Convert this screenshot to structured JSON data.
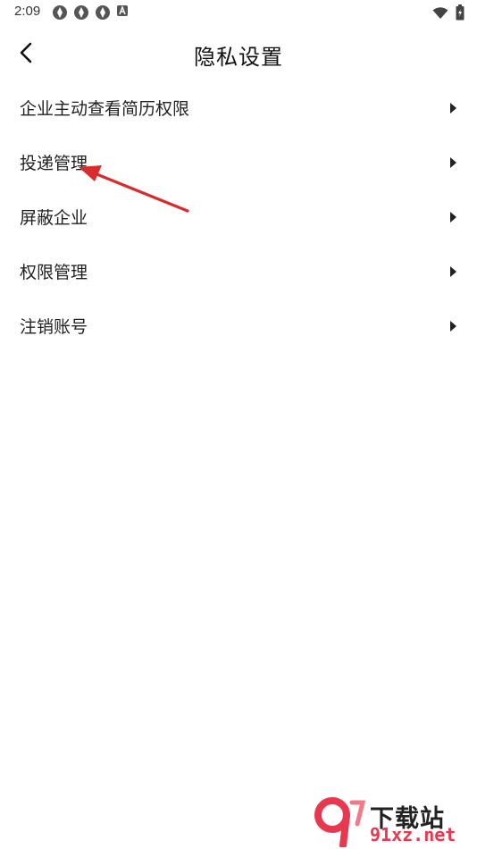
{
  "status_bar": {
    "time": "2:09",
    "left_icons": [
      "notification-icon",
      "notification-icon",
      "notification-icon",
      "a-icon"
    ],
    "right_icons": [
      "wifi-icon",
      "battery-icon"
    ]
  },
  "header": {
    "title": "隐私设置",
    "back_icon": "chevron-left-icon"
  },
  "menu": {
    "items": [
      {
        "label": "企业主动查看简历权限"
      },
      {
        "label": "投递管理"
      },
      {
        "label": "屏蔽企业"
      },
      {
        "label": "权限管理"
      },
      {
        "label": "注销账号"
      }
    ],
    "chevron_icon": "chevron-right-icon"
  },
  "watermark": {
    "title": "下载站",
    "domain": "91xz.net"
  },
  "colors": {
    "background": "#ffffff",
    "text": "#222222",
    "annotation": "#d92b2b",
    "watermark_red": "#e8384f"
  }
}
